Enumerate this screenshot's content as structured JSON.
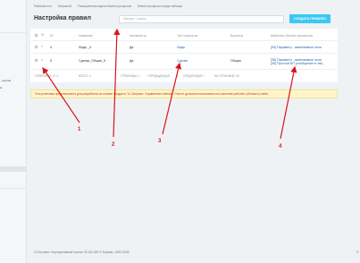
{
  "sidebar": {
    "items": [
      "...цессов",
      "м"
    ]
  },
  "breadcrumbs": [
    "Рабочий стол",
    "Битрикс24",
    "Расширенная модель бизнес-процессов",
    "Бизнес-процессы в виде таблицы"
  ],
  "page_title": "Настройка правил",
  "search": {
    "placeholder": "Фильтр + поиск"
  },
  "create_button": "СОЗДАТЬ ПРАВИЛО",
  "table": {
    "headers": {
      "id": "ID",
      "name": "Название",
      "activity": "Активность",
      "type": "Тип сущности",
      "funnel": "Воронка",
      "templates": "Шаблоны бизнес-процессов"
    },
    "rows": [
      {
        "id": "4",
        "name": "Лиды _4",
        "activity": "Да",
        "type": "Лиды",
        "funnel": "",
        "templates": [
          "[53] Параметр - заменяемые поля"
        ]
      },
      {
        "id": "5",
        "name": "Сделки_Общая_5",
        "activity": "Да",
        "type": "Сделки",
        "funnel": "Общая",
        "templates": [
          "[36] Параметр - заменяемые поля",
          "[45] Простой БП (сообщение в чат)"
        ]
      }
    ],
    "footer": {
      "selected": "ОТМЕЧЕНО: 0 / 2",
      "total": "ВСЕГО: 2",
      "pages": "СТРАНИЦЫ: 1",
      "prev": "< ПРЕДЫДУЩАЯ",
      "page_num": "1",
      "next": "СЛЕДУЮЩАЯ >",
      "per_page": "НА СТРАНИЦЕ: 20"
    }
  },
  "warning": "Эта установка предназначена для разработки на основе продукта \"1С-Битрикс: Управление сайтом\". Она не должна использоваться в качестве рабочего (боевого) сайта",
  "footer": {
    "copyright": "1С-Битрикс: Корпоративный портал 25.100.400 © Битрикс, 2002-2025",
    "right": "П"
  },
  "annotations": [
    "1",
    "2",
    "3",
    "4"
  ],
  "colors": {
    "accent": "#3bc8f5",
    "annotation": "#d8141b",
    "link": "#2067b0"
  }
}
